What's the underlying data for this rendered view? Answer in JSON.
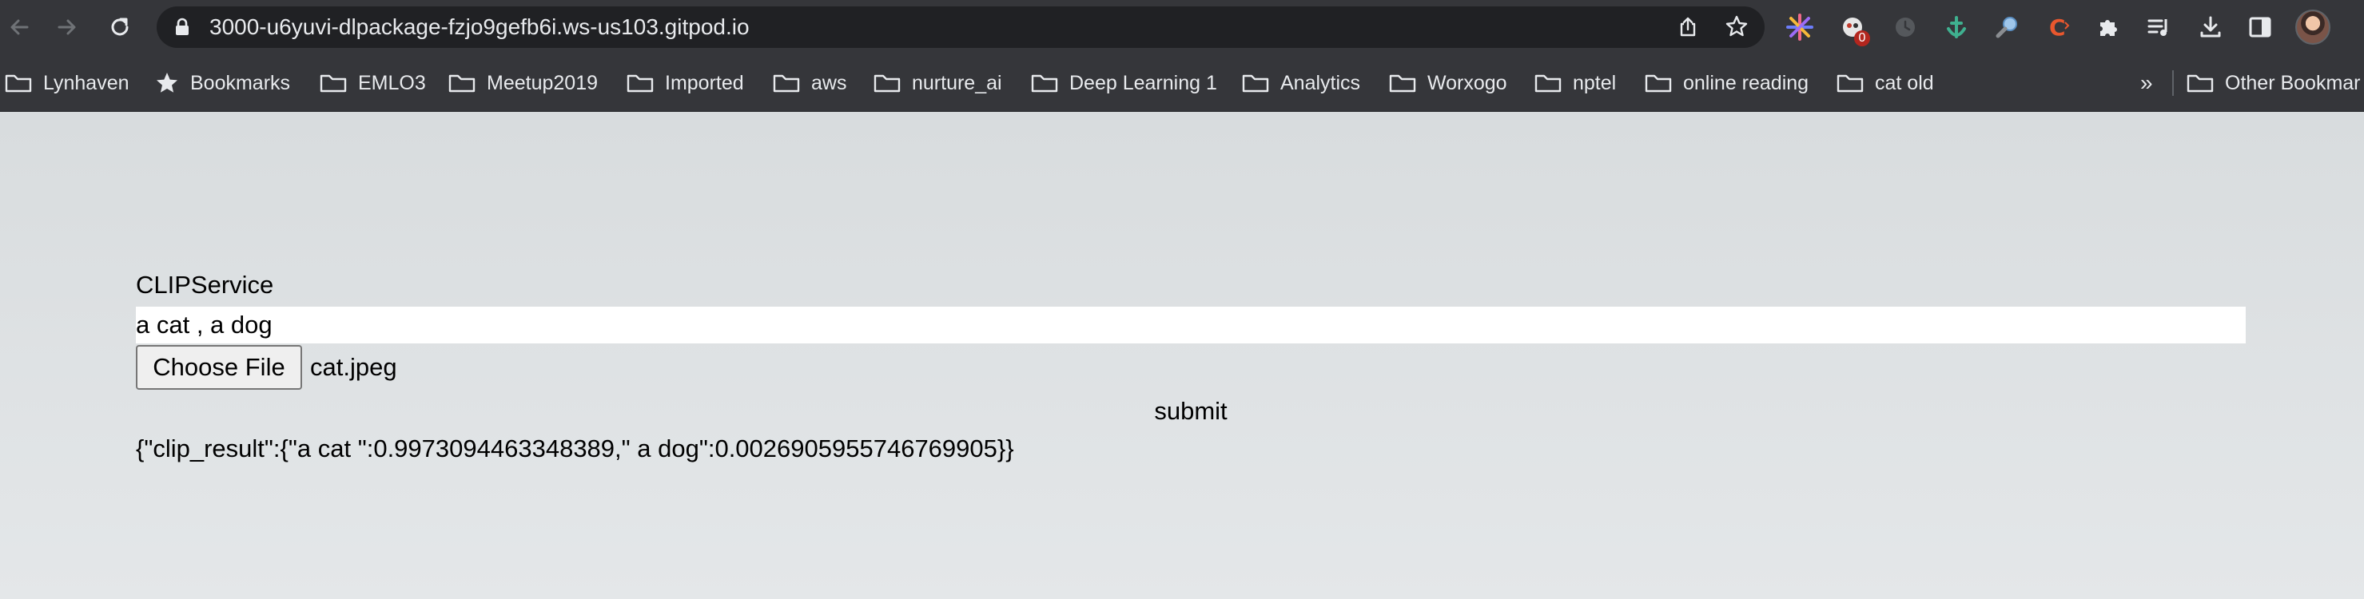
{
  "browser": {
    "url": "3000-u6yuvi-dlpackage-fzjo9gefb6i.ws-us103.gitpod.io",
    "extension_badge": "0",
    "more_bookmarks": "»",
    "bookmarks": [
      {
        "label": "Lynhaven",
        "icon": "folder-icon"
      },
      {
        "label": "Bookmarks",
        "icon": "star-icon"
      },
      {
        "label": "EMLO3",
        "icon": "folder-icon"
      },
      {
        "label": "Meetup2019",
        "icon": "folder-icon"
      },
      {
        "label": "Imported",
        "icon": "folder-icon"
      },
      {
        "label": "aws",
        "icon": "folder-icon"
      },
      {
        "label": "nurture_ai",
        "icon": "folder-icon"
      },
      {
        "label": "Deep Learning 1",
        "icon": "folder-icon"
      },
      {
        "label": "Analytics",
        "icon": "folder-icon"
      },
      {
        "label": "Worxogo",
        "icon": "folder-icon"
      },
      {
        "label": "nptel",
        "icon": "folder-icon"
      },
      {
        "label": "online reading",
        "icon": "folder-icon"
      },
      {
        "label": "cat old",
        "icon": "folder-icon"
      }
    ],
    "other_bookmarks": "Other Bookmar"
  },
  "page": {
    "title": "CLIPService",
    "text_input_value": "a cat , a dog",
    "file_button_label": "Choose File",
    "file_name": "cat.jpeg",
    "submit_label": "submit",
    "result": "{\"clip_result\":{\"a cat \":0.9973094463348389,\" a dog\":0.0026905955746769905}}"
  },
  "colors": {
    "chrome_bg": "#35363a",
    "omnibox_bg": "#202124",
    "page_bg": "#dcdfe1"
  }
}
